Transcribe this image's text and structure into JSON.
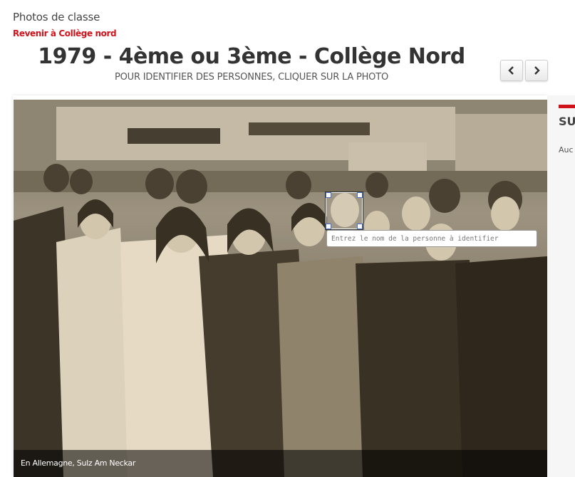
{
  "header": {
    "section_title": "Photos de classe",
    "back_link": "Revenir à Collège nord",
    "photo_title": "1979 - 4ème ou 3ème - Collège Nord",
    "instructions": "POUR IDENTIFIER DES PERSONNES, CLIQUER SUR LA PHOTO"
  },
  "navigation": {
    "prev_icon": "chevron-left-icon",
    "next_icon": "chevron-right-icon"
  },
  "photo": {
    "caption": "En Allemagne, Sulz Am Neckar",
    "tag_input_placeholder": "Entrez le nom de la personne à identifier",
    "tone": "sepia"
  },
  "side_panel": {
    "title": "SU",
    "empty_text": "Auc"
  },
  "colors": {
    "accent": "#d0121b",
    "caption_overlay": "rgba(0,0,0,0.55)"
  }
}
